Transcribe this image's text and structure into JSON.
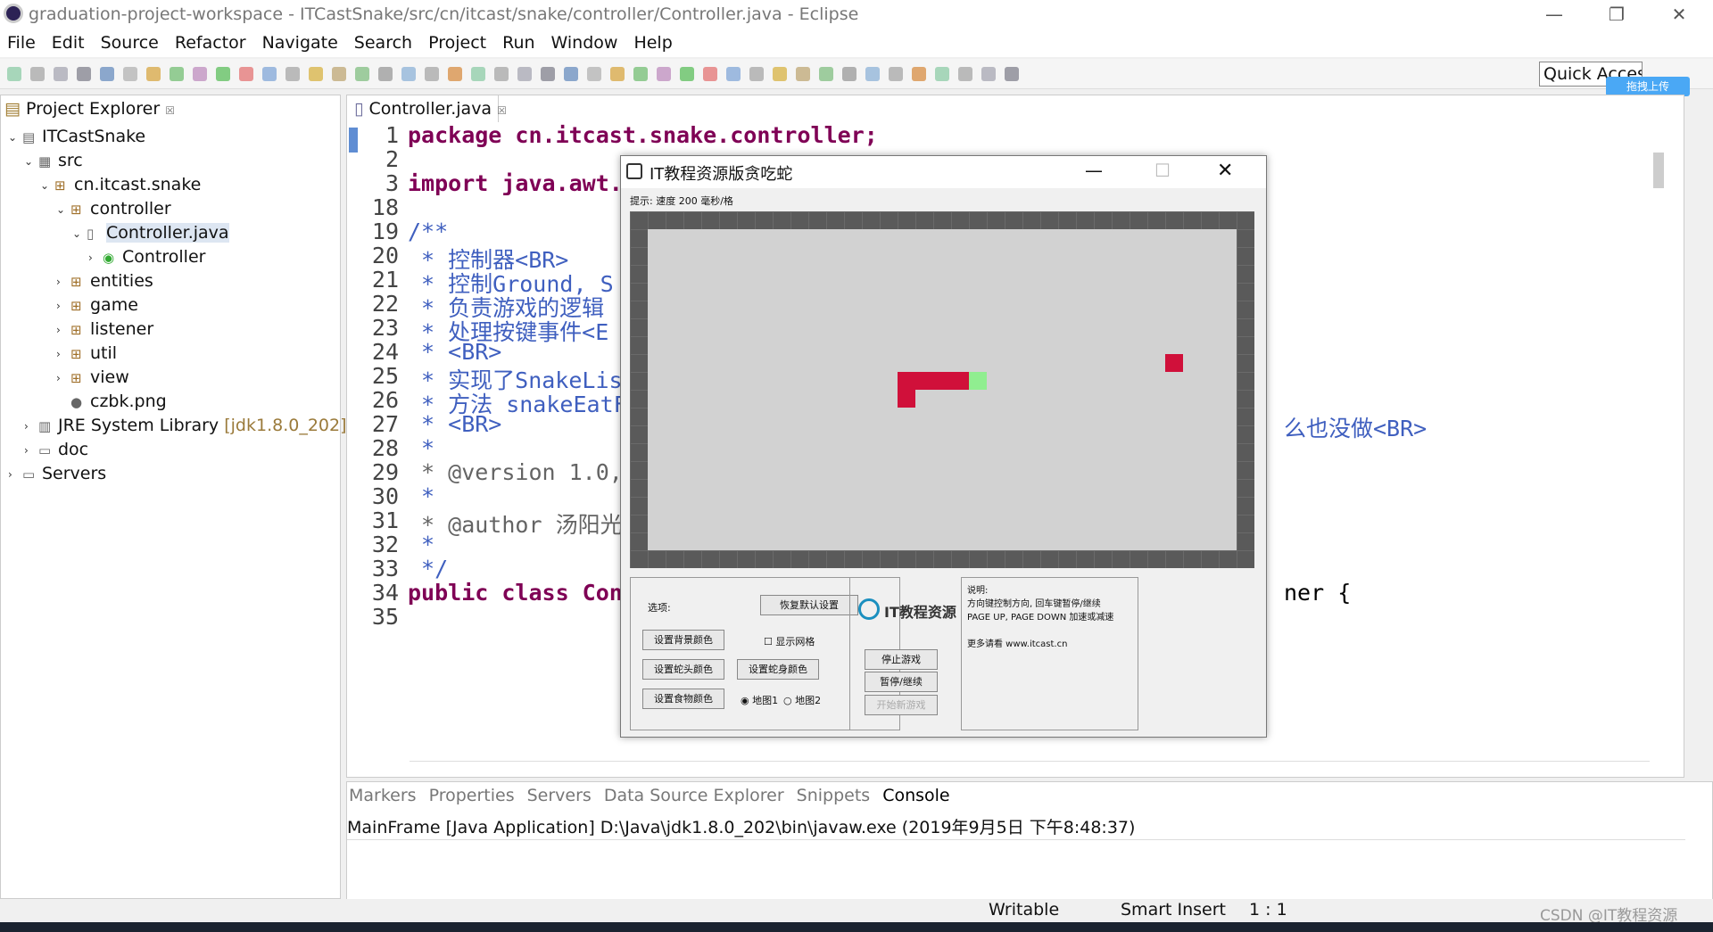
{
  "window": {
    "title": "graduation-project-workspace - ITCastSnake/src/cn/itcast/snake/controller/Controller.java - Eclipse",
    "min": "—",
    "max": "❐",
    "close": "✕"
  },
  "menu": [
    "File",
    "Edit",
    "Source",
    "Refactor",
    "Navigate",
    "Search",
    "Project",
    "Run",
    "Window",
    "Help"
  ],
  "quick_access": "Quick Access",
  "project_explorer": {
    "title": "Project Explorer",
    "tree": [
      {
        "label": "ITCastSnake",
        "depth": 0,
        "arrow": "⌄",
        "icon": "▤"
      },
      {
        "label": "src",
        "depth": 1,
        "arrow": "⌄",
        "icon": "▦"
      },
      {
        "label": "cn.itcast.snake",
        "depth": 2,
        "arrow": "⌄",
        "icon": "⊞"
      },
      {
        "label": "controller",
        "depth": 3,
        "arrow": "⌄",
        "icon": "⊞"
      },
      {
        "label": "Controller.java",
        "depth": 4,
        "arrow": "⌄",
        "icon": "▯"
      },
      {
        "label": "Controller",
        "depth": 5,
        "arrow": "›",
        "icon": "◉"
      },
      {
        "label": "entities",
        "depth": 3,
        "arrow": "›",
        "icon": "⊞"
      },
      {
        "label": "game",
        "depth": 3,
        "arrow": "›",
        "icon": "⊞"
      },
      {
        "label": "listener",
        "depth": 3,
        "arrow": "›",
        "icon": "⊞"
      },
      {
        "label": "util",
        "depth": 3,
        "arrow": "›",
        "icon": "⊞"
      },
      {
        "label": "view",
        "depth": 3,
        "arrow": "›",
        "icon": "⊞"
      },
      {
        "label": "czbk.png",
        "depth": 3,
        "arrow": "",
        "icon": "●"
      },
      {
        "label": "JRE System Library",
        "suffix": " [jdk1.8.0_202]",
        "depth": 1,
        "arrow": "›",
        "icon": "▥"
      },
      {
        "label": "doc",
        "depth": 1,
        "arrow": "›",
        "icon": "▭"
      },
      {
        "label": "Servers",
        "depth": 0,
        "arrow": "›",
        "icon": "▭"
      }
    ]
  },
  "editor": {
    "tab": "Controller.java",
    "lines": [
      {
        "n": "1",
        "t": "package cn.itcast.snake.controller;"
      },
      {
        "n": "2",
        "t": ""
      },
      {
        "n": "3",
        "t": "import java.awt."
      },
      {
        "n": "18",
        "t": ""
      },
      {
        "n": "19",
        "t": "/**"
      },
      {
        "n": "20",
        "t": " * 控制器<BR>"
      },
      {
        "n": "21",
        "t": " * 控制Ground, S"
      },
      {
        "n": "22",
        "t": " * 负责游戏的逻辑"
      },
      {
        "n": "23",
        "t": " * 处理按键事件<E"
      },
      {
        "n": "24",
        "t": " * <BR>"
      },
      {
        "n": "25",
        "t": " * 实现了SnakeLis"
      },
      {
        "n": "26",
        "t": " * 方法 snakeEatF"
      },
      {
        "n": "27",
        "t": " * <BR>"
      },
      {
        "n": "28",
        "t": " *"
      },
      {
        "n": "29",
        "t": " * @version 1.0,"
      },
      {
        "n": "30",
        "t": " *"
      },
      {
        "n": "31",
        "t": " * @author 汤阳光"
      },
      {
        "n": "32",
        "t": " *"
      },
      {
        "n": "33",
        "t": " */"
      },
      {
        "n": "34",
        "t": "public class Con"
      },
      {
        "n": "35",
        "t": ""
      }
    ],
    "tail26": "么也没做<BR>",
    "tail34": "ner {"
  },
  "bottom": {
    "tabs": [
      "Markers",
      "Properties",
      "Servers",
      "Data Source Explorer",
      "Snippets",
      "Console"
    ],
    "console": "MainFrame [Java Application] D:\\Java\\jdk1.8.0_202\\bin\\javaw.exe (2019年9月5日 下午8:48:37)"
  },
  "status": {
    "writable": "Writable",
    "insert": "Smart Insert",
    "pos": "1 : 1"
  },
  "watermark": "CSDN @IT教程资源",
  "upload": "拖拽上传",
  "game": {
    "title": "IT教程资源版贪吃蛇",
    "hint": "提示: 速度 200 毫秒/格",
    "options_label": "选项:",
    "restore": "恢复默认设置",
    "bg_color": "设置背景颜色",
    "show_grid": "显示网格",
    "head_color": "设置蛇头颜色",
    "body_color": "设置蛇身颜色",
    "food_color": "设置食物颜色",
    "map1": "地图1",
    "map2": "地图2",
    "logo": "IT教程资源",
    "stop": "停止游戏",
    "pause": "暂停/继续",
    "new_game": "开始新游戏",
    "help": [
      "说明:",
      "方向键控制方向, 回车键暂停/继续",
      "PAGE UP, PAGE DOWN 加速或减速",
      "",
      "更多请看 www.itcast.cn"
    ],
    "colors": {
      "snake": "#d0103a",
      "head": "#90ee90",
      "food": "#d0103a"
    }
  }
}
